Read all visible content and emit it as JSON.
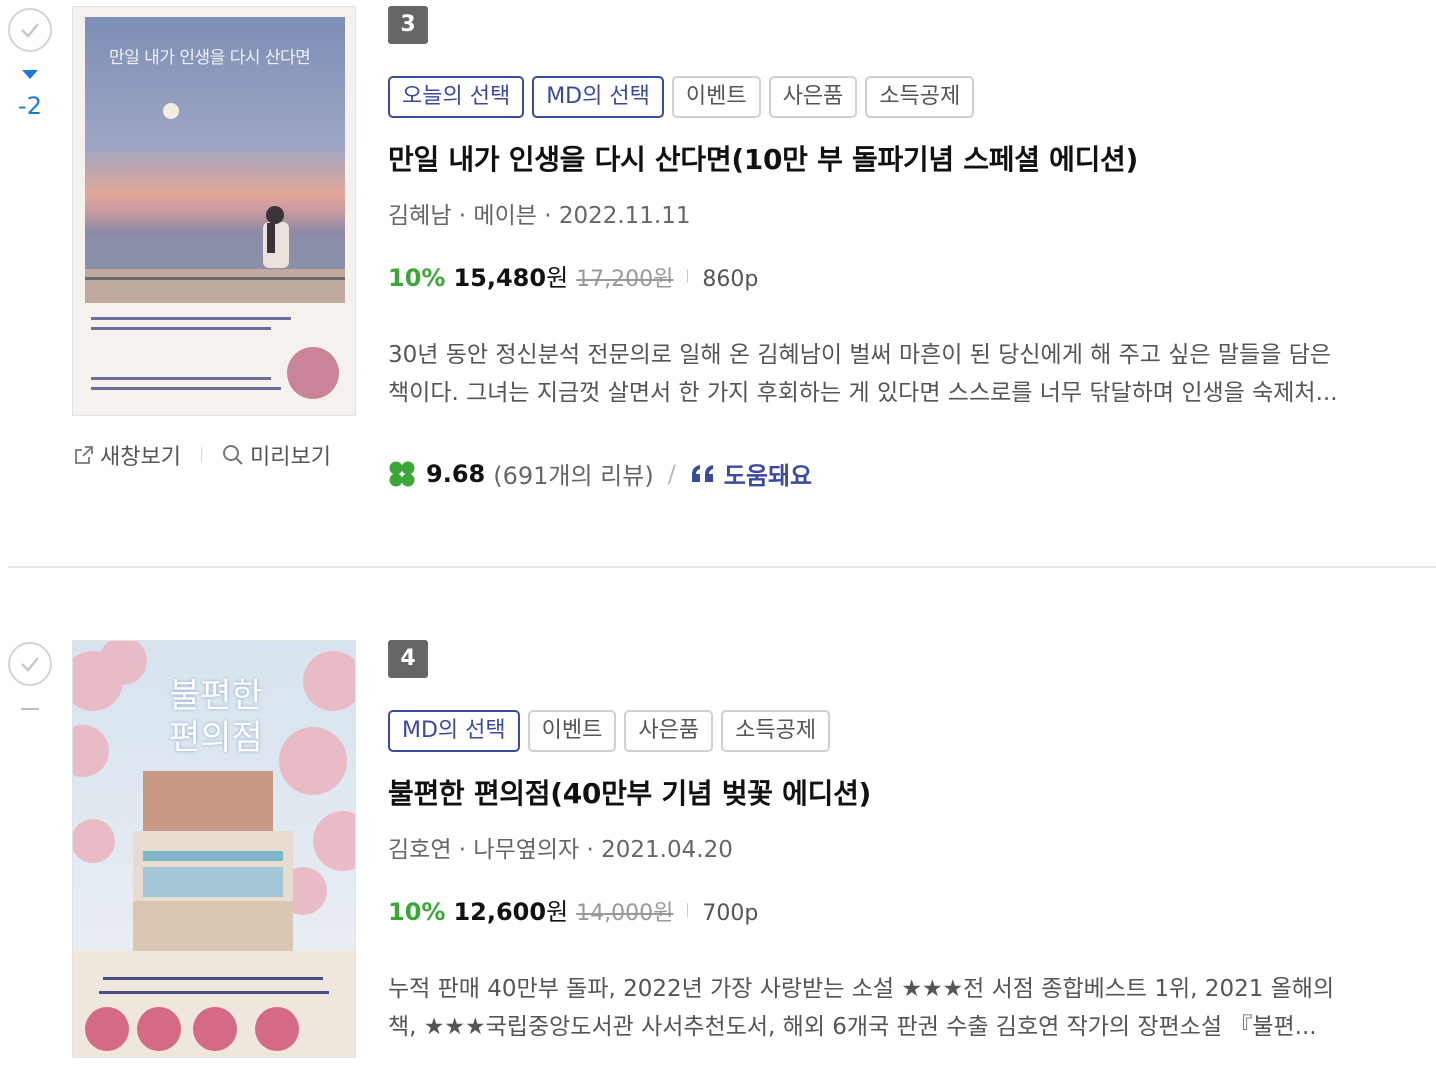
{
  "items": [
    {
      "rank": "3",
      "rank_change": "-2",
      "tags": [
        "오늘의 선택",
        "MD의 선택",
        "이벤트",
        "사은품",
        "소득공제"
      ],
      "title": "만일 내가 인생을 다시 산다면(10만 부 돌파기념 스페셜 에디션)",
      "meta": "김혜남 · 메이븐 · 2022.11.11",
      "discount": "10%",
      "price": "15,480",
      "won": "원",
      "original_price": "17,200원",
      "pages": "860p",
      "desc_line1": "30년 동안 정신분석 전문의로 일해 온 김혜남이 벌써 마흔이 된 당신에게 해 주고 싶은 말들을 담은",
      "desc_line2": "책이다. 그녀는 지금껏 살면서 한 가지 후회하는 게 있다면 스스로를 너무 닦달하며 인생을 숙제처...",
      "rating": "9.68",
      "review_count": "(691개의 리뷰)",
      "review_slash": "/",
      "helpful": "도움돼요",
      "cover_title": "만일 내가 인생을 다시 산다면"
    },
    {
      "rank": "4",
      "tags": [
        "MD의 선택",
        "이벤트",
        "사은품",
        "소득공제"
      ],
      "title": "불편한 편의점(40만부 기념 벚꽃 에디션)",
      "meta": "김호연 · 나무옆의자 · 2021.04.20",
      "discount": "10%",
      "price": "12,600",
      "won": "원",
      "original_price": "14,000원",
      "pages": "700p",
      "desc_line1": "누적 판매 40만부 돌파, 2022년 가장 사랑받는 소설 ★★★전 서점 종합베스트 1위, 2021 올해의",
      "desc_line2": "책, ★★★국립중앙도서관 사서추천도서, 해외 6개국 판권 수출 김호연 작가의 장편소설 『불편...",
      "cover_title": "불편한 편의점"
    }
  ],
  "links": {
    "new_window": "새창보기",
    "preview": "미리보기"
  },
  "colors": {
    "accent_blue": "#3b4a9e",
    "discount_green": "#3aa736",
    "rank_down": "#1a7ad6"
  },
  "icons": [
    "check-icon",
    "triangle-down-icon",
    "external-link-icon",
    "search-icon",
    "clover-icon",
    "quote-icon"
  ]
}
